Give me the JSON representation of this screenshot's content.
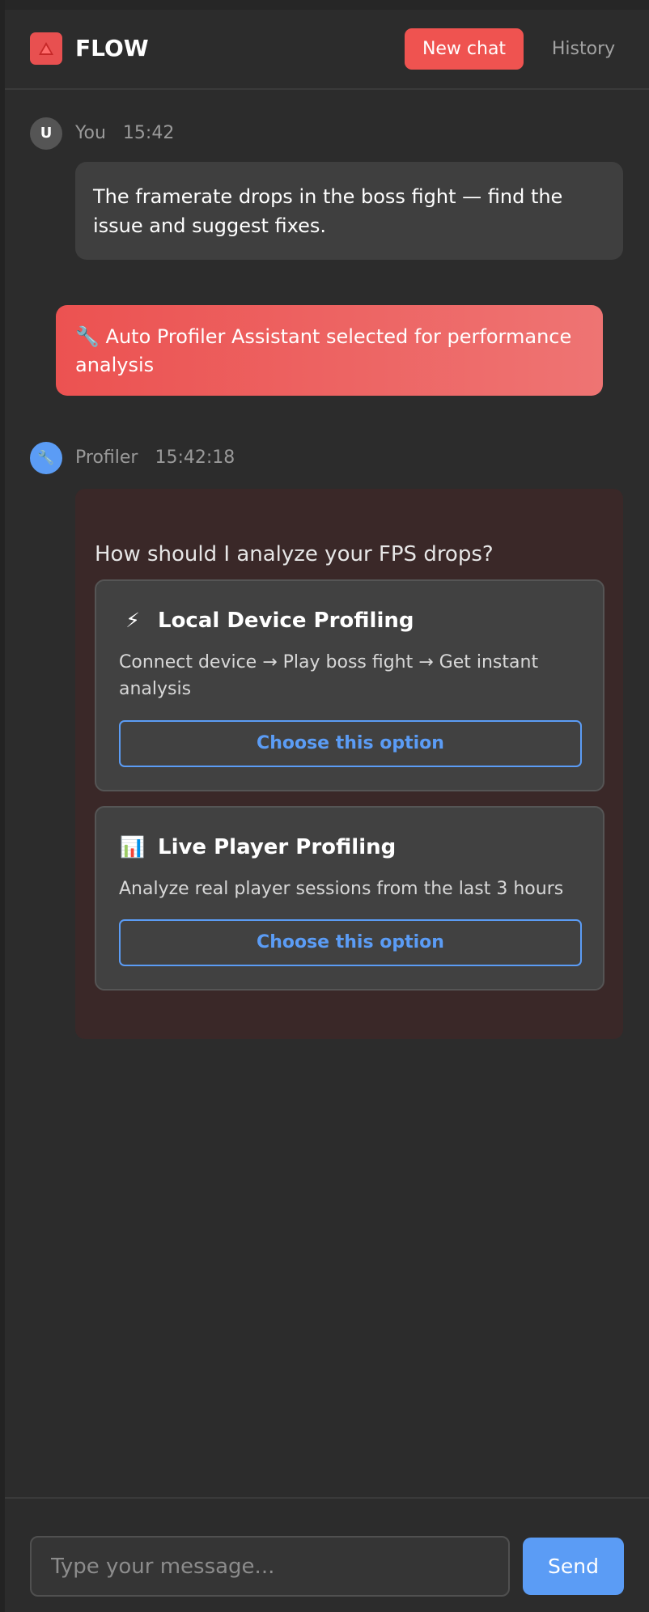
{
  "header": {
    "brand": "FLOW",
    "logo_icon": "warning-triangle-icon",
    "new_chat_label": "New chat",
    "history_label": "History",
    "accent_color": "#ef5350"
  },
  "messages": {
    "user": {
      "avatar_letter": "U",
      "name": "You",
      "time": "15:42",
      "text": "The framerate drops in the boss fight — find the issue and suggest fixes."
    },
    "system_banner": {
      "icon": "🔧",
      "text": "Auto Profiler Assistant selected for performance analysis"
    },
    "bot": {
      "avatar_icon": "🔧",
      "name": "Profiler",
      "time": "15:42:18",
      "question": "How should I analyze your FPS drops?",
      "options": [
        {
          "icon": "⚡",
          "title": "Local Device Profiling",
          "description": "Connect device → Play boss fight → Get instant analysis",
          "button_label": "Choose this option"
        },
        {
          "icon": "📊",
          "title": "Live Player Profiling",
          "description": "Analyze real player sessions from the last 3 hours",
          "button_label": "Choose this option"
        }
      ]
    }
  },
  "composer": {
    "placeholder": "Type your message...",
    "value": "",
    "send_label": "Send",
    "send_color": "#5b9cf5"
  }
}
